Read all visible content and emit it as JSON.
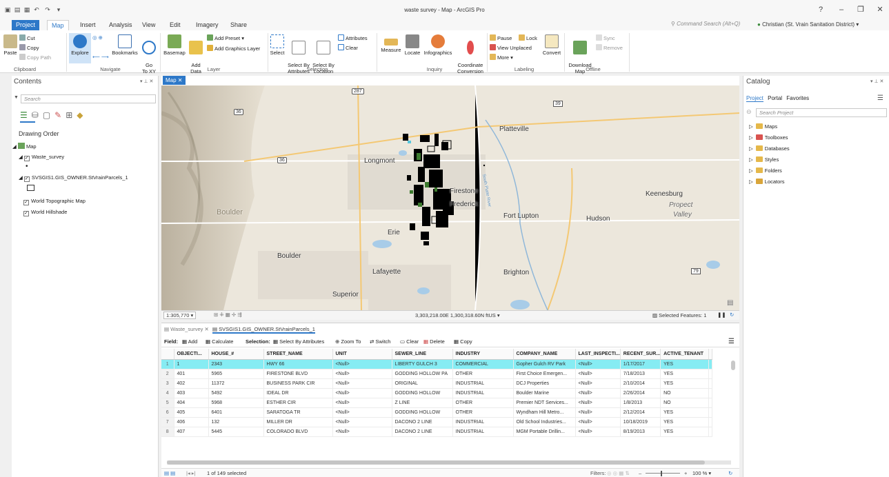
{
  "window": {
    "title": "waste survey - Map - ArcGIS Pro",
    "help": "?",
    "minimize": "–",
    "restore": "❐",
    "close": "✕"
  },
  "tabs": [
    "Project",
    "Map",
    "Insert",
    "Analysis",
    "View",
    "Edit",
    "Imagery",
    "Share"
  ],
  "command_search": {
    "placeholder": "Command Search (Alt+Q)"
  },
  "user": {
    "name": "Christian (St. Vrain Sanitation District) ▾"
  },
  "ribbon": {
    "clipboard": {
      "paste": "Paste",
      "cut": "Cut",
      "copy": "Copy",
      "copy_path": "Copy Path",
      "label": "Clipboard"
    },
    "navigate": {
      "explore": "Explore",
      "bookmarks": "Bookmarks",
      "goto": "Go\nTo XY",
      "label": "Navigate"
    },
    "layer": {
      "basemap": "Basemap",
      "add_data": "Add\nData",
      "add_preset": "Add Preset ▾",
      "add_graphics": "Add Graphics Layer",
      "label": "Layer"
    },
    "selection": {
      "select": "Select",
      "select_attr": "Select By\nAttributes",
      "select_loc": "Select By\nLocation",
      "attributes": "Attributes",
      "clear": "Clear",
      "label": "Selection"
    },
    "inquiry": {
      "measure": "Measure",
      "locate": "Locate",
      "infographics": "Infographics",
      "coord": "Coordinate\nConversion",
      "label": "Inquiry"
    },
    "labeling": {
      "pause": "Pause",
      "lock": "Lock",
      "view_unplaced": "View Unplaced",
      "more": "More ▾",
      "convert": "Convert",
      "label": "Labeling"
    },
    "offline": {
      "download": "Download\nMap",
      "sync": "Sync",
      "remove": "Remove",
      "label": "Offline"
    }
  },
  "contents": {
    "title": "Contents",
    "search_placeholder": "Search",
    "drawing_order": "Drawing Order",
    "layers": [
      "Map",
      "Waste_survey",
      "SVSGIS1.GIS_OWNER.StVrainParcels_1",
      "World Topographic Map",
      "World Hillshade"
    ]
  },
  "map": {
    "tab": "Map",
    "labels": [
      "Platteville",
      "Longmont",
      "Firestone",
      "Frederick",
      "Fort Lupton",
      "Hudson",
      "Keenesburg",
      "Propect",
      "Valley",
      "Erie",
      "Boulder",
      "Boulder",
      "Lafayette",
      "Brighton",
      "Superior"
    ],
    "shields": [
      "287",
      "36",
      "39",
      "36",
      "79"
    ],
    "river": "South Platte River",
    "scale": "1:305,770",
    "coords": "3,303,218.00E 1,300,318.60N ftUS",
    "selected_features": "Selected Features: 1"
  },
  "table": {
    "tabs": [
      "Waste_survey",
      "SVSGIS1.GIS_OWNER.StVrainParcels_1"
    ],
    "toolbar": {
      "field": "Field:",
      "add": "Add",
      "calculate": "Calculate",
      "selection": "Selection:",
      "select_by_attr": "Select By Attributes",
      "zoom_to": "Zoom To",
      "switch": "Switch",
      "clear": "Clear",
      "delete": "Delete",
      "copy": "Copy"
    },
    "columns": [
      "OBJECTI...",
      "HOUSE_#",
      "STREET_NAME",
      "UNIT",
      "SEWER_LINE",
      "INDUSTRY",
      "COMPANY_NAME",
      "LAST_INSPECTI...",
      "RECENT_SUR...",
      "ACTIVE_TENANT"
    ],
    "rows": [
      [
        "1",
        "2343",
        "HWY 66",
        "<Null>",
        "LIBERTY GULCH 3",
        "COMMERCIAL",
        "Gopher Gulch RV Park",
        "<Null>",
        "1/17/2017",
        "YES"
      ],
      [
        "401",
        "5965",
        "FIRESTONE BLVD",
        "<Null>",
        "GODDING HOLLOW PA",
        "OTHER",
        "First Choice Emergen...",
        "<Null>",
        "7/18/2013",
        "YES"
      ],
      [
        "402",
        "11372",
        "BUSINESS PARK CIR",
        "<Null>",
        "ORIGINAL",
        "INDUSTRIAL",
        "DCJ Properties",
        "<Null>",
        "2/10/2014",
        "YES"
      ],
      [
        "403",
        "5492",
        "IDEAL DR",
        "<Null>",
        "GODDING HOLLOW",
        "INDUSTRIAL",
        "Boulder Marine",
        "<Null>",
        "2/26/2014",
        "NO"
      ],
      [
        "404",
        "5968",
        "ESTHER CIR",
        "<Null>",
        "Z LINE",
        "OTHER",
        "Premier NDT Services...",
        "<Null>",
        "1/8/2013",
        "NO"
      ],
      [
        "405",
        "6401",
        "SARATOGA TR",
        "<Null>",
        "GODDING HOLLOW",
        "OTHER",
        "Wyndham Hill Metro...",
        "<Null>",
        "2/12/2014",
        "YES"
      ],
      [
        "406",
        "132",
        "MILLER DR",
        "<Null>",
        "DACONO 2 LINE",
        "INDUSTRIAL",
        "Old School Industries...",
        "<Null>",
        "10/18/2019",
        "YES"
      ],
      [
        "407",
        "5445",
        "COLORADO BLVD",
        "<Null>",
        "DACONO 2 LINE",
        "INDUSTRIAL",
        "MGM Portable Drillin...",
        "<Null>",
        "8/19/2013",
        "YES"
      ]
    ],
    "selected_row": 0,
    "status": "1 of 149 selected",
    "filters": "Filters:",
    "zoom": "100 %"
  },
  "catalog": {
    "title": "Catalog",
    "tabs": [
      "Project",
      "Portal",
      "Favorites"
    ],
    "search_placeholder": "Search Project",
    "items": [
      "Maps",
      "Toolboxes",
      "Databases",
      "Styles",
      "Folders",
      "Locators"
    ]
  }
}
